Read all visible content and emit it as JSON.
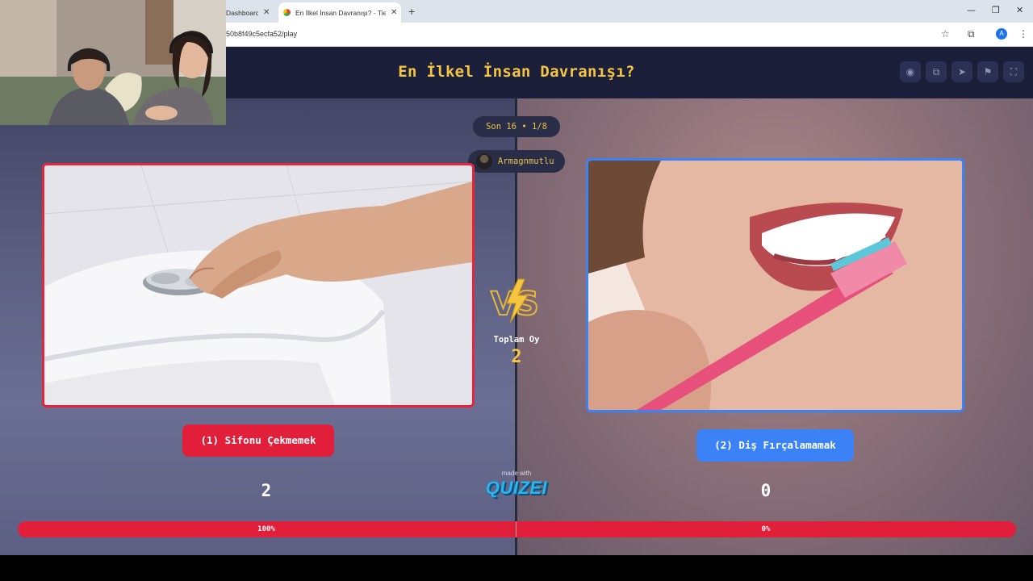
{
  "browser": {
    "tabs": [
      {
        "title": "Dashboard",
        "active": false
      },
      {
        "title": "En İlkel İnsan Davranışı? - Tier L",
        "active": true
      }
    ],
    "new_tab": "+",
    "url": "50b8f49c5ecfa52/play",
    "profile_initial": "A",
    "icons": [
      "star-icon",
      "extensions-icon",
      "menu-icon"
    ],
    "window_controls": [
      "minimize",
      "restore",
      "close"
    ]
  },
  "game": {
    "title": "En İlkel İnsan Davranışı?",
    "header_icons": [
      "eye-icon",
      "copy-icon",
      "share-icon",
      "flag-icon",
      "fullscreen-icon"
    ],
    "round": "Son 16 • 1/8",
    "author": "Armagnmutlu",
    "total_votes_label": "Toplam Oy",
    "total_votes": "2",
    "made_with": "made with",
    "brand": "QUIZEI",
    "colors": {
      "left": "#e21f3a",
      "right": "#3b82f6",
      "accent": "#f5c542",
      "header": "#1c1f3a"
    },
    "options": [
      {
        "label": "(1) Sifonu Çekmemek",
        "votes": "2",
        "percent_label": "100%",
        "share": 1.0,
        "image": "hand pressing toilet flush button"
      },
      {
        "label": "(2) Diş Fırçalamamak",
        "votes": "0",
        "percent_label": "0%",
        "share": 0.0,
        "image": "smiling woman brushing teeth with pink toothbrush"
      }
    ]
  }
}
